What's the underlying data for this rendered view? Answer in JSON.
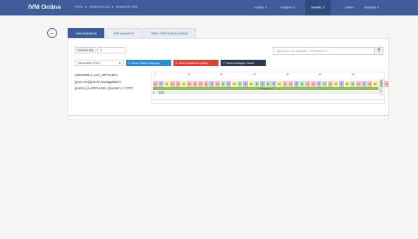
{
  "navbar": {
    "brand": "IVM Online",
    "crumbs": [
      "Home",
      "▸",
      "Sequence List",
      "▸",
      "Sequence View"
    ],
    "menu": [
      {
        "label": "Isolate ∨"
      },
      {
        "label": "Antigens ∨"
      },
      {
        "label": "Genetic ∨",
        "active": true
      },
      {
        "label": "Admin"
      },
      {
        "label": "Settings ∨"
      }
    ],
    "colors": {
      "bar": "#3e5d98",
      "active": "#2f4a7e"
    }
  },
  "tabs": [
    "View sequence",
    "Edit sequence",
    "View / Edit Version History"
  ],
  "toolbar": {
    "current_site_label": "Current Site",
    "current_site_value": "1",
    "search_placeholder": "Type here. Ex: example : ATGGGCATT",
    "search_icon": "search-icon",
    "display_select": "Nucleotide Form",
    "btn_features": "✔ Show Feature Manager",
    "btn_quality": "✔ Show Sequence Quality",
    "btn_ambiguity": "✔ Show Ambiguity Colour"
  },
  "viewer": {
    "names": [
      "lcl|9910995 1_xxxx_x0RA4186 1",
      "[gene=HA] [protein=hemagglutinin]",
      "[protein_id=AGRA4186 1] [location=1..1707]"
    ],
    "ruler": [
      "1",
      "10",
      "20",
      "30",
      "40",
      "50",
      "60"
    ],
    "sequence": [
      "A",
      "T",
      "G",
      "A",
      "A",
      "G",
      "A",
      "A",
      "A",
      "A",
      "T",
      "A",
      "C",
      "T",
      "G",
      "C",
      "T",
      "G",
      "C",
      "T",
      "C",
      "T",
      "G",
      "A",
      "A",
      "T",
      "C",
      "A",
      "A",
      "T",
      "C",
      "A",
      "G",
      "T",
      "G",
      "C",
      "A",
      "T",
      "A",
      "G",
      "G",
      "A"
    ],
    "feature_label": "Hemagglutinin"
  }
}
